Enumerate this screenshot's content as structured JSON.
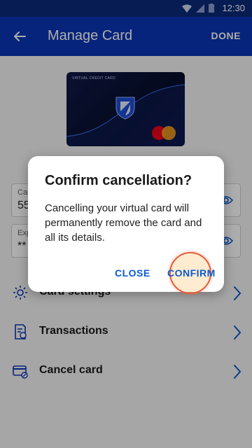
{
  "status_bar": {
    "time": "12:30"
  },
  "app_bar": {
    "title": "Manage Card",
    "done_label": "DONE"
  },
  "card": {
    "label": "VIRTUAL CREDIT CARD"
  },
  "fields": [
    {
      "label": "Car",
      "value": "55"
    },
    {
      "label": "Exp",
      "value": "**"
    }
  ],
  "menu": [
    {
      "label": "Card settings",
      "icon": "gear-icon"
    },
    {
      "label": "Transactions",
      "icon": "receipt-icon"
    },
    {
      "label": "Cancel card",
      "icon": "card-cancel-icon"
    }
  ],
  "dialog": {
    "title": "Confirm cancellation?",
    "body": "Cancelling your virtual card will permanently remove the card and all its details.",
    "close_label": "CLOSE",
    "confirm_label": "CONFIRM"
  },
  "colors": {
    "app_bar": "#0a35b5",
    "status_bar": "#0a2a7a",
    "accent": "#0a5ad2",
    "tap_ring": "#e85b3a"
  }
}
